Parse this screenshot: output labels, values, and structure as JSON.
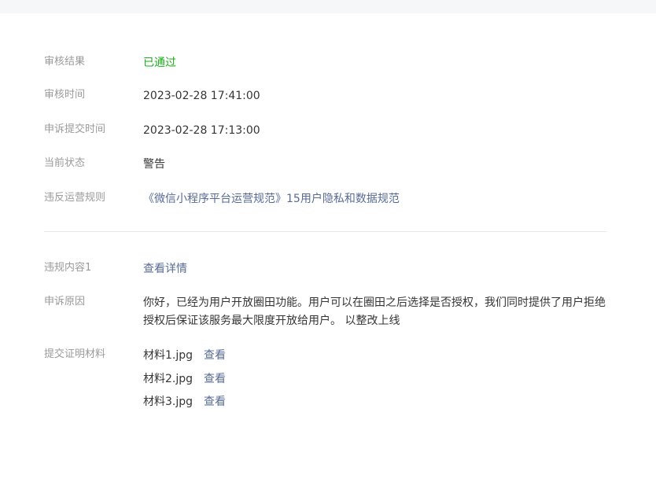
{
  "review": {
    "result_label": "审核结果",
    "result_value": "已通过",
    "time_label": "审核时间",
    "time_value": "2023-02-28 17:41:00",
    "appeal_time_label": "申诉提交时间",
    "appeal_time_value": "2023-02-28 17:13:00",
    "status_label": "当前状态",
    "status_value": "警告",
    "rule_label": "违反运营规则",
    "rule_value": "《微信小程序平台运营规范》15用户隐私和数据规范"
  },
  "violation": {
    "content_label": "违规内容1",
    "content_link": "查看详情",
    "reason_label": "申诉原因",
    "reason_text": "你好，已经为用户开放圈田功能。用户可以在圈田之后选择是否授权，我们同时提供了用户拒绝授权后保证该服务最大限度开放给用户。 以整改上线",
    "materials_label": "提交证明材料",
    "materials": [
      {
        "name": "材料1.jpg",
        "action": "查看"
      },
      {
        "name": "材料2.jpg",
        "action": "查看"
      },
      {
        "name": "材料3.jpg",
        "action": "查看"
      }
    ]
  },
  "colors": {
    "success": "#1aad19",
    "link": "#576b95",
    "label": "#9a9a9a",
    "text": "#353535"
  }
}
